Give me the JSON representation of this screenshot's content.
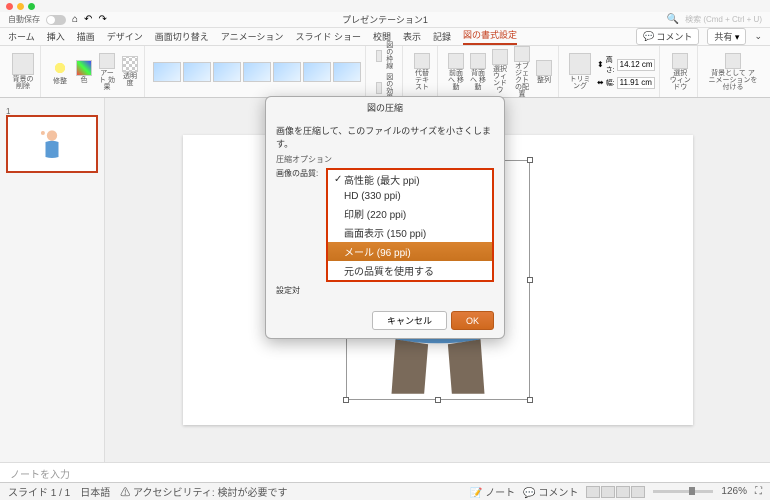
{
  "titlebar": {
    "auto_save": "自動保存",
    "doc_title": "プレゼンテーション1",
    "search_placeholder": "検索 (Cmd + Ctrl + U)",
    "comment_btn": "コメント",
    "share_btn": "共有"
  },
  "tabs": {
    "home": "ホーム",
    "insert": "挿入",
    "draw": "描画",
    "design": "デザイン",
    "transitions": "画面切り替え",
    "animations": "アニメーション",
    "slideshow": "スライド ショー",
    "review": "校閲",
    "view": "表示",
    "record": "記録",
    "picture_format": "図の書式設定"
  },
  "ribbon": {
    "remove_bg": "背景の\n削除",
    "corrections": "修整",
    "color": "色",
    "artistic": "アート\n効果",
    "transparency": "透明度",
    "pic_border": "図の枠線",
    "pic_effects": "図の効果",
    "alt_text": "代替\nテキスト",
    "bring_forward": "前面へ\n移動",
    "send_backward": "背面へ\n移動",
    "selection_pane": "選択\nウィンドウ",
    "object_pos": "オブジェクト\nの配置",
    "align": "整列",
    "crop": "トリミング",
    "height_val": "14.12 cm",
    "width_val": "11.91 cm",
    "selection_window": "選択\nウィンドウ",
    "add_anim": "背景として\nアニメーションを付ける"
  },
  "dialog": {
    "title": "図の圧縮",
    "description": "画像を圧縮して、このファイルのサイズを小さくします。",
    "options_header": "圧縮オプション",
    "quality_label": "画像の品質:",
    "settings_label": "設定対",
    "options": {
      "max": "高性能 (最大 ppi)",
      "hd": "HD (330 ppi)",
      "print": "印刷 (220 ppi)",
      "screen": "画面表示 (150 ppi)",
      "mail": "メール (96 ppi)",
      "original": "元の品質を使用する"
    },
    "cancel": "キャンセル",
    "ok": "OK"
  },
  "notes": {
    "placeholder": "ノートを入力"
  },
  "status": {
    "slide": "スライド 1 / 1",
    "lang": "日本語",
    "a11y": "アクセシビリティ: 検討が必要です",
    "notes_btn": "ノート",
    "comments_btn": "コメント",
    "zoom": "126%"
  }
}
